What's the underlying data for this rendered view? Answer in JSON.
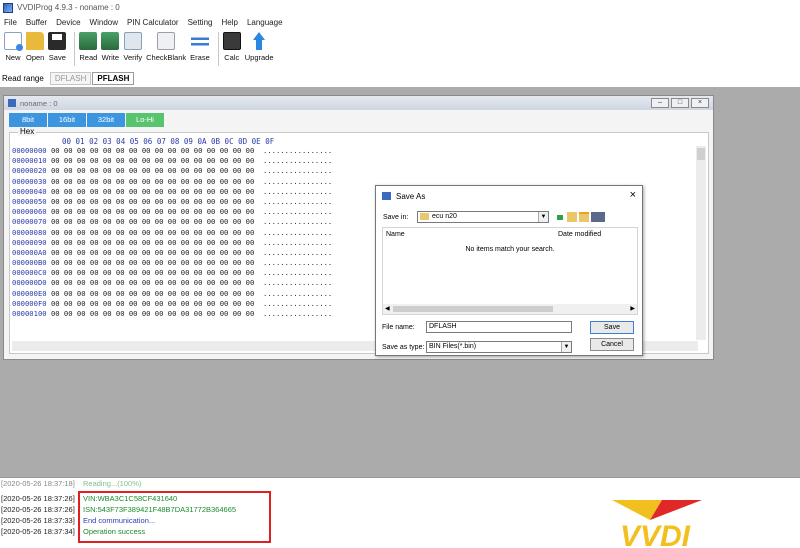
{
  "window": {
    "title": "VVDIProg 4.9.3 - noname : 0"
  },
  "menu": [
    "File",
    "Buffer",
    "Device",
    "Window",
    "PIN Calculator",
    "Setting",
    "Help",
    "Language"
  ],
  "toolbar": [
    {
      "label": "New",
      "icon": "new-icon",
      "color": "#6a8fc8"
    },
    {
      "label": "Open",
      "icon": "folder-open-icon",
      "color": "#e8b93a"
    },
    {
      "label": "Save",
      "icon": "floppy-icon",
      "color": "#2a2a2a"
    },
    {
      "label": "Read",
      "icon": "chip-read-icon",
      "color": "#3a8a5a"
    },
    {
      "label": "Write",
      "icon": "chip-write-icon",
      "color": "#3a8a5a"
    },
    {
      "label": "Verify",
      "icon": "verify-icon",
      "color": "#8aa0b8"
    },
    {
      "label": "CheckBlank",
      "icon": "check-blank-icon",
      "color": "#9aa0aa"
    },
    {
      "label": "Erase",
      "icon": "erase-icon",
      "color": "#3a7ad8"
    },
    {
      "label": "Calc",
      "icon": "calculator-icon",
      "color": "#3a3a3a"
    },
    {
      "label": "Upgrade",
      "icon": "upgrade-arrow-icon",
      "color": "#2a86e0"
    }
  ],
  "read_range": {
    "label": "Read range",
    "tabs": [
      {
        "label": "DFLASH",
        "active": false
      },
      {
        "label": "PFLASH",
        "active": true
      }
    ]
  },
  "hex_window": {
    "title": "noname : 0",
    "bit_tabs": [
      "8bit",
      "16bit",
      "32bit",
      "Lo-Hi"
    ],
    "group_label": "Hex",
    "header": "00 01 02 03 04 05 06 07 08 09 0A 0B 0C 0D 0E 0F",
    "addresses": [
      "00000000",
      "00000010",
      "00000020",
      "00000030",
      "00000040",
      "00000050",
      "00000060",
      "00000070",
      "00000080",
      "00000090",
      "000000A0",
      "000000B0",
      "000000C0",
      "000000D0",
      "000000E0",
      "000000F0",
      "00000100"
    ],
    "byte_fill": "00 00 00 00 00 00 00 00 00 00 00 00 00 00 00 00",
    "ascii_fill": "................"
  },
  "save_dialog": {
    "title": "Save As",
    "save_in_label": "Save in:",
    "save_in_value": "ecu n20",
    "col_name": "Name",
    "col_date": "Date modified",
    "empty_message": "No items match your search.",
    "file_name_label": "File name:",
    "file_name_value": "DFLASH",
    "save_type_label": "Save as type:",
    "save_type_value": "BIN Files(*.bin)",
    "save_button": "Save",
    "cancel_button": "Cancel"
  },
  "log": [
    {
      "ts": "[2020-05-26 18:37:18]",
      "msg": "Reading...(100%)",
      "color": "green",
      "faded": true
    },
    {
      "ts": "[2020-05-26 18:37:26]",
      "msg": "VIN:WBA3C1C58CF431640",
      "color": "green",
      "faded": false
    },
    {
      "ts": "[2020-05-26 18:37:26]",
      "msg": "ISN:543F73F389421F48B7DA31772B364665",
      "color": "green",
      "faded": false
    },
    {
      "ts": "[2020-05-26 18:37:33]",
      "msg": "End communication...",
      "color": "blue",
      "faded": false
    },
    {
      "ts": "[2020-05-26 18:37:34]",
      "msg": "Operation success",
      "color": "green",
      "faded": false
    }
  ],
  "logo": {
    "text": "VVDI",
    "colors": {
      "yellow": "#f2c01e",
      "red": "#e02828"
    }
  }
}
